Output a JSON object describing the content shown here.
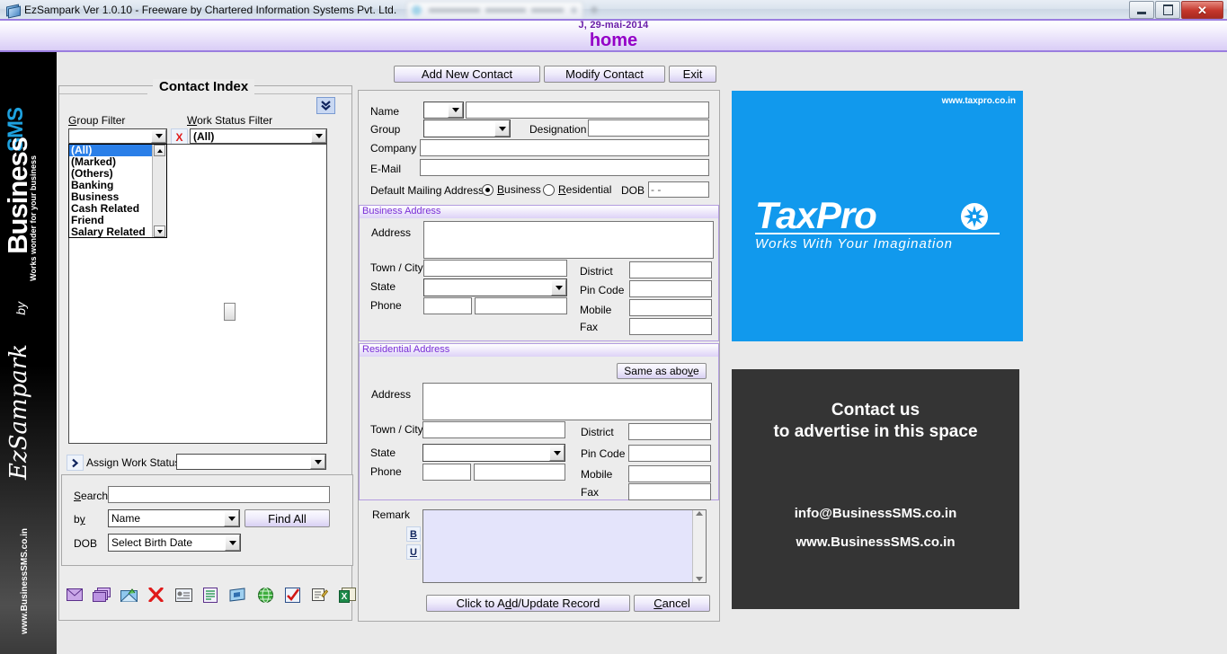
{
  "window": {
    "title": "EzSampark Ver 1.0.10 - Freeware by Chartered Information Systems Pvt. Ltd.",
    "minimize": "–",
    "maximize": "❐",
    "close": "✕"
  },
  "header": {
    "date": "J, 29-mai-2014",
    "title": "home"
  },
  "rail": {
    "sms": "SMS",
    "business": "Business",
    "tagline": "Works wonder for your business",
    "by": "by",
    "product": "EzSampark",
    "url": "www.BusinessSMS.co.in"
  },
  "toolbar": {
    "add_new_contact": "Add New Contact",
    "modify_contact": "Modify Contact",
    "exit": "Exit"
  },
  "contact_index": {
    "legend": "Contact Index",
    "group_filter_label": "Group Filter",
    "work_status_filter_label": "Work Status Filter",
    "group_filter_value": "",
    "work_status_filter_value": "(All)",
    "clear_icon": "X",
    "expand_icon": "chevron-double-down",
    "group_options": [
      "(All)",
      "(Marked)",
      "(Others)",
      "Banking",
      "Business",
      "Cash Related",
      "Friend",
      "Salary Related"
    ],
    "group_selected": "(All)",
    "assign_work_status_label": "Assign Work Status",
    "assign_work_status_value": "",
    "results": []
  },
  "search": {
    "search_label": "Search",
    "search_value": "",
    "by_label": "by",
    "by_value": "Name",
    "find_all": "Find All",
    "dob_label": "DOB",
    "dob_value": "Select Birth Date"
  },
  "icon_bar": [
    {
      "name": "send-email-icon",
      "glyph": "✉"
    },
    {
      "name": "bulk-email-icon",
      "glyph": "✉"
    },
    {
      "name": "open-mail-icon",
      "glyph": "✉"
    },
    {
      "name": "delete-icon",
      "glyph": "✕"
    },
    {
      "name": "business-card-icon",
      "glyph": "▤"
    },
    {
      "name": "report-icon",
      "glyph": "▤"
    },
    {
      "name": "slideshow-icon",
      "glyph": "▶"
    },
    {
      "name": "globe-icon",
      "glyph": "●"
    },
    {
      "name": "checklist-icon",
      "glyph": "✓"
    },
    {
      "name": "notes-icon",
      "glyph": "✎"
    },
    {
      "name": "excel-export-icon",
      "glyph": "X"
    }
  ],
  "form": {
    "name_label": "Name",
    "name_title_value": "",
    "name_value": "",
    "group_label": "Group",
    "group_value": "",
    "designation_label": "Designation",
    "designation_value": "",
    "company_label": "Company",
    "company_value": "",
    "email_label": "E-Mail",
    "email_value": "",
    "default_mailing_label": "Default Mailing Address",
    "radio_business": "Business",
    "radio_residential": "Residential",
    "radio_selected": "Business",
    "dob_label": "DOB",
    "dob_value": "- -"
  },
  "business_address": {
    "legend": "Business Address",
    "address_label": "Address",
    "address_value": "",
    "town_label": "Town / City",
    "town_value": "",
    "district_label": "District",
    "district_value": "",
    "state_label": "State",
    "state_value": "",
    "pin_label": "Pin Code",
    "pin_value": "",
    "phone_label": "Phone",
    "phone_code_value": "",
    "phone_value": "",
    "mobile_label": "Mobile",
    "mobile_value": "",
    "fax_label": "Fax",
    "fax_value": ""
  },
  "residential_address": {
    "legend": "Residential Address",
    "same_as_above": "Same as above",
    "address_label": "Address",
    "address_value": "",
    "town_label": "Town / City",
    "town_value": "",
    "district_label": "District",
    "district_value": "",
    "state_label": "State",
    "state_value": "",
    "pin_label": "Pin Code",
    "pin_value": "",
    "phone_label": "Phone",
    "phone_code_value": "",
    "phone_value": "",
    "mobile_label": "Mobile",
    "mobile_value": "",
    "fax_label": "Fax",
    "fax_value": ""
  },
  "remark": {
    "label": "Remark",
    "bold": "B",
    "underline": "U",
    "value": ""
  },
  "actions": {
    "save": "Click to Add/Update Record",
    "cancel": "Cancel"
  },
  "ads": {
    "taxpro": {
      "url": "www.taxpro.co.in",
      "logo": "TaxPro",
      "slogan": "Works With Your Imagination",
      "bg": "#1199ed"
    },
    "house": {
      "line1": "Contact us",
      "line2": "to advertise in this space",
      "email": "info@BusinessSMS.co.in",
      "website": "www.BusinessSMS.co.in",
      "bg": "#343434"
    }
  }
}
